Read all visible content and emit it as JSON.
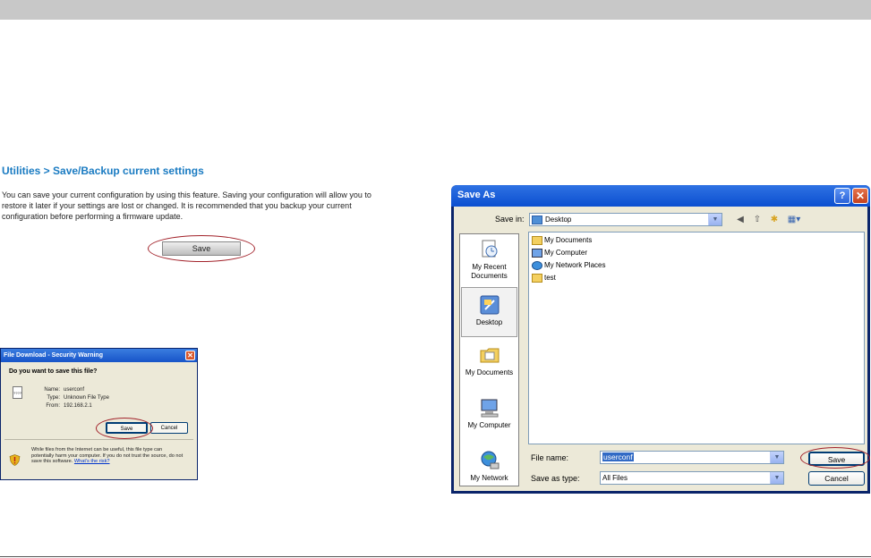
{
  "page": {
    "heading": "Utilities > Save/Backup current settings",
    "intro_line1": "You can save your current configuration by using this feature. Saving your configuration will allow you to",
    "intro_line2": "restore it later if your settings are lost or changed. It is recommended that you backup your current",
    "intro_line3": "configuration before performing a firmware update.",
    "save_button": "Save"
  },
  "file_download": {
    "title": "File Download - Security Warning",
    "question": "Do you want to save this file?",
    "file_icon_text": "????",
    "name_key": "Name:",
    "name_val": "userconf",
    "type_key": "Type:",
    "type_val": "Unknown File Type",
    "from_key": "From:",
    "from_val": "192.168.2.1",
    "save_label": "Save",
    "cancel_label": "Cancel",
    "warning_line1": "While files from the Internet can be useful, this file type can",
    "warning_line2": "potentially harm your computer. If you do not trust the source, do not",
    "warning_line3": "save this software.",
    "warning_link": "What's the risk?"
  },
  "save_as": {
    "title": "Save As",
    "help": "?",
    "close": "✕",
    "save_in_label": "Save in:",
    "save_in_value": "Desktop",
    "places": [
      {
        "label": "My Recent\nDocuments"
      },
      {
        "label": "Desktop"
      },
      {
        "label": "My Documents"
      },
      {
        "label": "My Computer"
      },
      {
        "label": "My Network"
      }
    ],
    "files": [
      "My Documents",
      "My Computer",
      "My Network Places",
      "test"
    ],
    "file_name_label": "File name:",
    "file_name_value": "userconf",
    "save_as_type_label": "Save as type:",
    "save_as_type_value": "All Files",
    "save_label": "Save",
    "cancel_label": "Cancel"
  }
}
